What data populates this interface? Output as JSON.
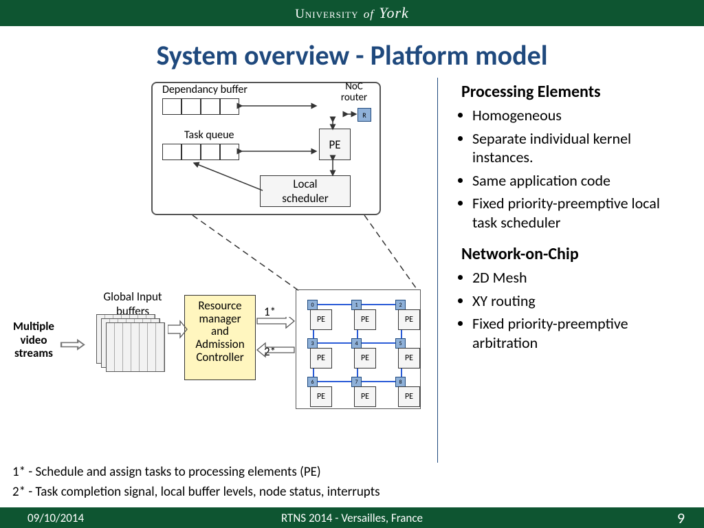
{
  "header": {
    "university": "University of York"
  },
  "title": "System overview - Platform model",
  "right": {
    "section1": {
      "heading": "Processing Elements",
      "items": [
        "Homogeneous",
        "Separate individual kernel instances.",
        "Same application code",
        "Fixed priority-preemptive local task scheduler"
      ]
    },
    "section2": {
      "heading": "Network-on-Chip",
      "items": [
        "2D Mesh",
        "XY routing",
        "Fixed priority-preemptive arbitration"
      ]
    }
  },
  "diagram": {
    "dep_buffer_label": "Dependancy buffer",
    "noc_router_label": "NoC router",
    "task_queue_label": "Task queue",
    "pe_label": "PE",
    "scheduler_label": "Local scheduler",
    "mvs_label": "Multiple video streams",
    "gib_label": "Global Input buffers",
    "rmac_label": "Resource manager and Admission Controller",
    "arrow1_label": "1*",
    "arrow2_label": "2*",
    "router_chip_label": "R",
    "grid_indices": [
      "0",
      "1",
      "2",
      "3",
      "4",
      "5",
      "6",
      "7",
      "8"
    ]
  },
  "legend": {
    "l1": "1* -   Schedule and assign tasks to processing elements (PE)",
    "l2": "2* -   Task completion signal, local buffer levels, node status, interrupts"
  },
  "footer": {
    "date": "09/10/2014",
    "venue": "RTNS 2014 - Versailles, France",
    "page": "9"
  }
}
